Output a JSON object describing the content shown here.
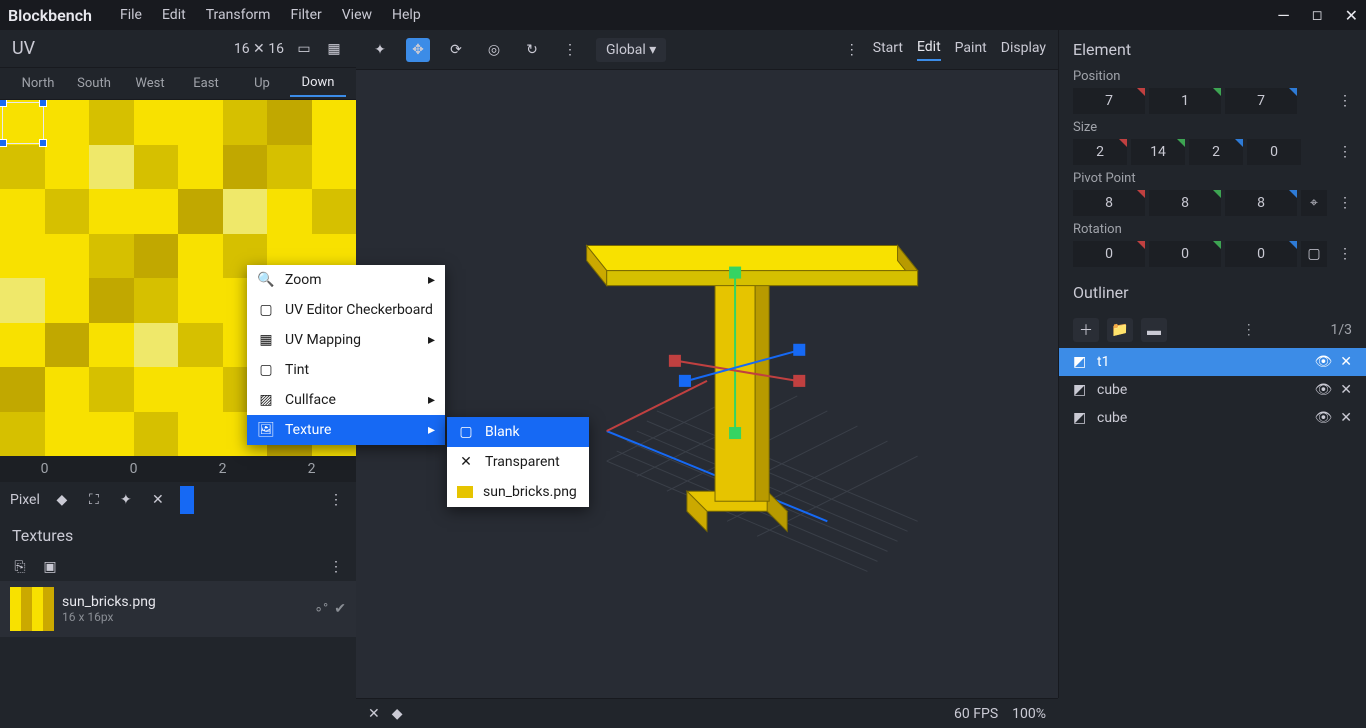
{
  "app": {
    "title": "Blockbench"
  },
  "menu": {
    "items": [
      "File",
      "Edit",
      "Transform",
      "Filter",
      "View",
      "Help"
    ]
  },
  "modes": {
    "items": [
      "Start",
      "Edit",
      "Paint",
      "Display"
    ],
    "active": "Edit"
  },
  "toolbar": {
    "orientation_label": "Global"
  },
  "uv": {
    "title": "UV",
    "resolution": "16 ✕ 16",
    "faces": [
      "North",
      "South",
      "West",
      "East",
      "Up",
      "Down"
    ],
    "active_face": "Down",
    "coords": [
      "0",
      "0",
      "2",
      "2"
    ],
    "brush_label": "Pixel"
  },
  "textures": {
    "title": "Textures",
    "items": [
      {
        "name": "sun_bricks.png",
        "size": "16 x 16px"
      }
    ]
  },
  "context_menu": {
    "items": [
      {
        "label": "Zoom",
        "icon": "search",
        "arrow": true
      },
      {
        "label": "UV Editor Checkerboard",
        "icon": "square"
      },
      {
        "label": "UV Mapping",
        "icon": "uvmap",
        "arrow": true
      },
      {
        "label": "Tint",
        "icon": "square"
      },
      {
        "label": "Cullface",
        "icon": "dashed",
        "arrow": true
      },
      {
        "label": "Texture",
        "icon": "image",
        "arrow": true,
        "highlight": true
      }
    ],
    "submenu": [
      {
        "label": "Blank",
        "icon": "square",
        "highlight": true
      },
      {
        "label": "Transparent",
        "icon": "x"
      },
      {
        "label": "sun_bricks.png",
        "icon": "tex"
      }
    ]
  },
  "element": {
    "title": "Element",
    "position": {
      "label": "Position",
      "values": [
        "7",
        "1",
        "7"
      ]
    },
    "size": {
      "label": "Size",
      "values": [
        "2",
        "14",
        "2",
        "0"
      ]
    },
    "pivot": {
      "label": "Pivot Point",
      "values": [
        "8",
        "8",
        "8"
      ]
    },
    "rotation": {
      "label": "Rotation",
      "values": [
        "0",
        "0",
        "0"
      ]
    }
  },
  "outliner": {
    "title": "Outliner",
    "counter": "1/3",
    "items": [
      {
        "name": "t1",
        "selected": true
      },
      {
        "name": "cube"
      },
      {
        "name": "cube"
      }
    ]
  },
  "status": {
    "fps": "60 FPS",
    "zoom": "100%"
  }
}
